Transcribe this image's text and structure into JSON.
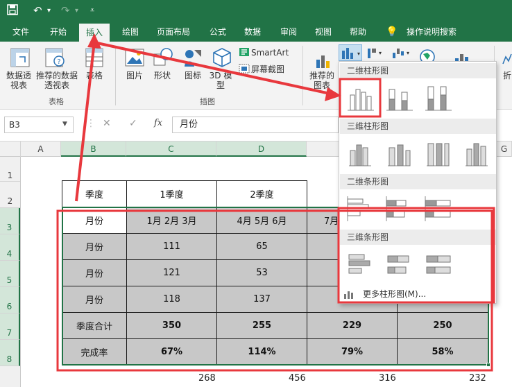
{
  "tabs": [
    "文件",
    "开始",
    "插入",
    "绘图",
    "页面布局",
    "公式",
    "数据",
    "审阅",
    "视图",
    "帮助"
  ],
  "search_label": "操作说明搜索",
  "ribbon": {
    "pivot_label": "数据透视表",
    "recommended_pivot_label": "推荐的数据透视表",
    "table_label": "表格",
    "group_table": "表格",
    "picture_label": "图片",
    "shapes_label": "形状",
    "icons_label": "图标",
    "model3d_label": "3D 模型",
    "smartart_label": "SmartArt",
    "screenshot_label": "屏幕截图",
    "group_illustrations": "插图",
    "recommended_charts_label": "推荐的图表",
    "fold_label": "折"
  },
  "formula_bar": {
    "name_box": "B3",
    "formula": "月份"
  },
  "columns": [
    "A",
    "B",
    "C",
    "D",
    "G"
  ],
  "rows": [
    "1",
    "2",
    "3",
    "4",
    "5",
    "6",
    "7",
    "8"
  ],
  "table": {
    "header": [
      "季度",
      "1季度",
      "2季度"
    ],
    "rows": [
      [
        "月份",
        "1月 2月 3月",
        "4月 5月 6月",
        "7月"
      ],
      [
        "月份",
        "111",
        "65"
      ],
      [
        "月份",
        "121",
        "53"
      ],
      [
        "月份",
        "118",
        "137"
      ],
      [
        "季度合计",
        "350",
        "255",
        "229",
        "250"
      ],
      [
        "完成率",
        "67%",
        "114%",
        "79%",
        "58%"
      ]
    ]
  },
  "bottom_numbers": [
    "268",
    "456",
    "316",
    "232"
  ],
  "dropdown": {
    "section1": "二维柱形图",
    "section2": "三维柱形图",
    "section3": "二维条形图",
    "section4": "三维条形图",
    "more": "更多柱形图(M)..."
  },
  "colors": {
    "excel_green": "#217346",
    "annotation_red": "#e8383d",
    "table_gray": "#c8c8c8"
  }
}
